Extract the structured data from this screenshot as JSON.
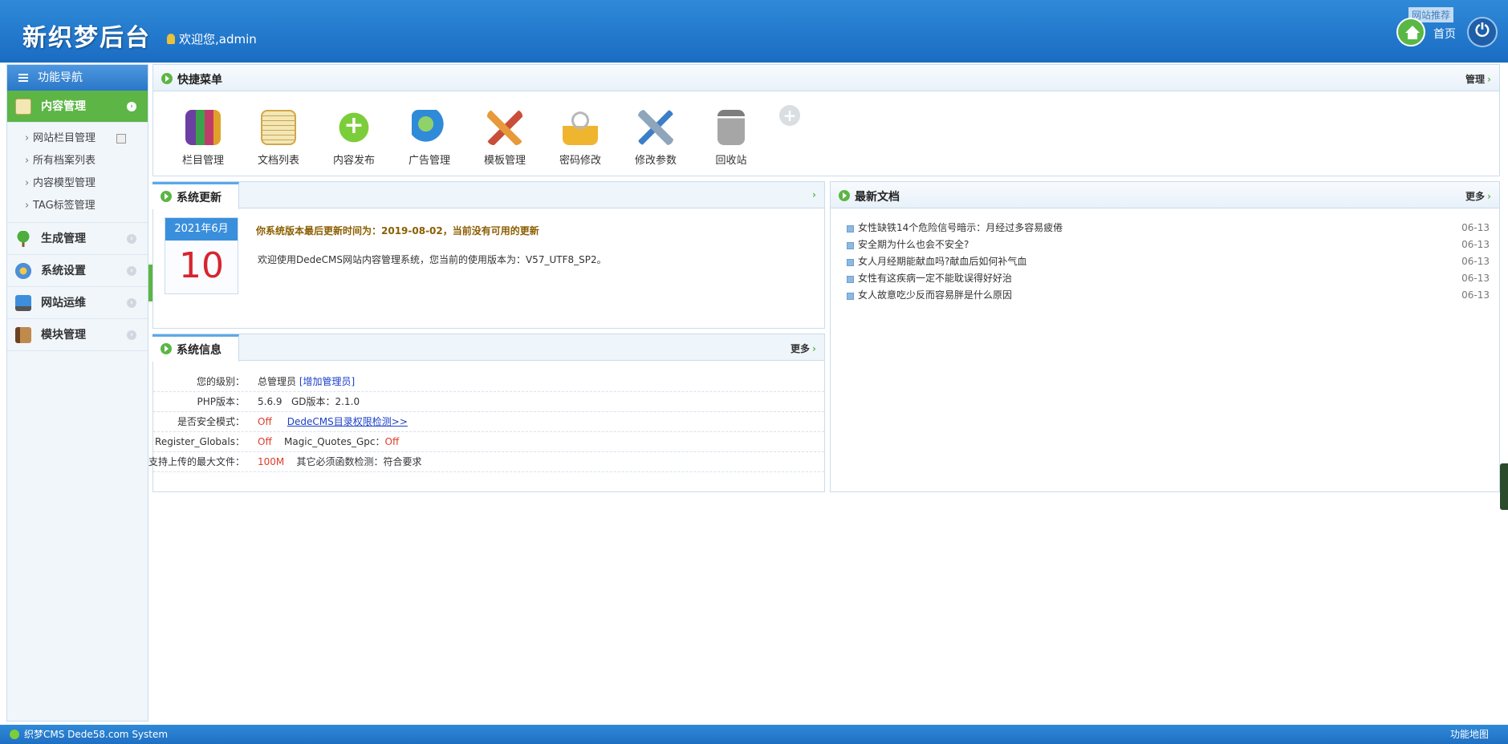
{
  "header": {
    "logo": "新织梦后台",
    "welcome": "欢迎您,admin",
    "top_button": "网站推荐",
    "home_label": "首页"
  },
  "sidebar": {
    "title": "功能导航",
    "categories": [
      {
        "label": "内容管理",
        "active": true
      },
      {
        "label": "生成管理"
      },
      {
        "label": "系统设置"
      },
      {
        "label": "网站运维"
      },
      {
        "label": "模块管理"
      }
    ],
    "sub_items": [
      "网站栏目管理",
      "所有档案列表",
      "内容模型管理",
      "TAG标签管理"
    ]
  },
  "quick_menu": {
    "title": "快捷菜单",
    "manage": "管理",
    "items": [
      "栏目管理",
      "文档列表",
      "内容发布",
      "广告管理",
      "模板管理",
      "密码修改",
      "修改参数",
      "回收站"
    ]
  },
  "update": {
    "title": "系统更新",
    "month": "2021年6月",
    "day": "10",
    "line1": "你系统版本最后更新时间为：2019-08-02，当前没有可用的更新",
    "line2": "欢迎使用DedeCMS网站内容管理系统，您当前的使用版本为：V57_UTF8_SP2。"
  },
  "sysinfo": {
    "title": "系统信息",
    "more": "更多",
    "rows": [
      {
        "label": "您的级别：",
        "value": "总管理员",
        "extra": "[增加管理员]"
      },
      {
        "label": "PHP版本：",
        "value": "5.6.9",
        "extra": "GD版本：2.1.0"
      },
      {
        "label": "是否安全模式：",
        "value": "Off",
        "extra": "DedeCMS目录权限检测>>"
      },
      {
        "label": "Register_Globals：",
        "value": "Off",
        "extra_label": "Magic_Quotes_Gpc：",
        "extra": "Off"
      },
      {
        "label": "支持上传的最大文件：",
        "value": "100M",
        "extra": "其它必须函数检测：符合要求"
      }
    ]
  },
  "news": {
    "title": "最新文档",
    "more": "更多",
    "items": [
      {
        "title": "女性缺铁14个危险信号暗示：月经过多容易疲倦",
        "date": "06-13"
      },
      {
        "title": "安全期为什么也会不安全?",
        "date": "06-13"
      },
      {
        "title": "女人月经期能献血吗?献血后如何补气血",
        "date": "06-13"
      },
      {
        "title": "女性有这疾病一定不能耽误得好好治",
        "date": "06-13"
      },
      {
        "title": "女人故意吃少反而容易胖是什么原因",
        "date": "06-13"
      }
    ]
  },
  "footer": {
    "left": "织梦CMS  Dede58.com System",
    "right": "功能地图"
  },
  "colors": {
    "header_blue": "#2f8ad8",
    "accent_green": "#5cb544",
    "alert_red": "#e03a2a"
  }
}
